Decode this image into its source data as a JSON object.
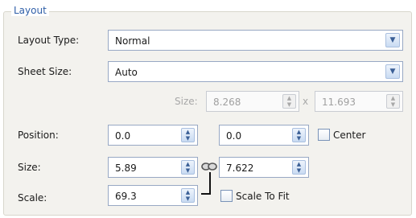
{
  "group": {
    "title": "Layout"
  },
  "layout_type": {
    "label": "Layout Type:",
    "value": "Normal"
  },
  "sheet_size": {
    "label": "Sheet Size:",
    "value": "Auto"
  },
  "custom_size": {
    "label": "Size:",
    "width": "8.268",
    "separator": "x",
    "height": "11.693"
  },
  "position": {
    "label": "Position:",
    "x": "0.0",
    "y": "0.0",
    "center_label": "Center",
    "center_checked": false
  },
  "size": {
    "label": "Size:",
    "width": "5.89",
    "height": "7.622"
  },
  "scale": {
    "label": "Scale:",
    "value": "69.3",
    "fit_label": "Scale To Fit",
    "fit_checked": false
  },
  "icons": {
    "dropdown": "chevron-down-icon",
    "spinner": "spin-arrows-icon",
    "link": "chain-link-icon"
  }
}
